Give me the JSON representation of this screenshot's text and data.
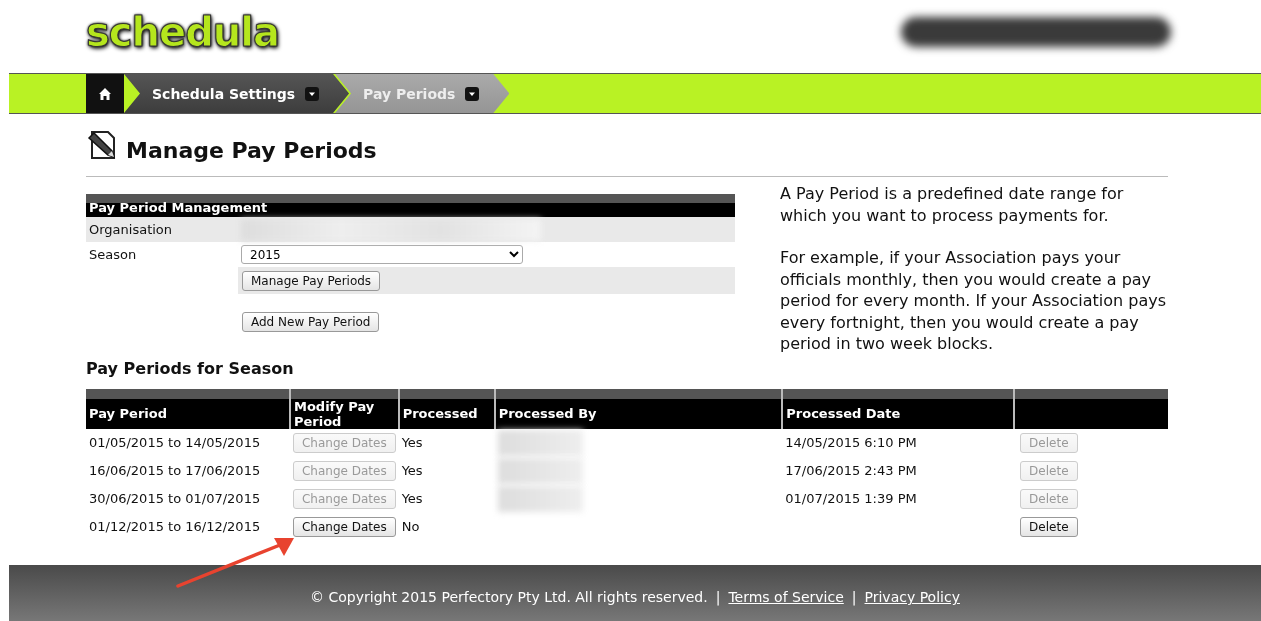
{
  "header": {
    "logo": "schedula",
    "account_blurred": true
  },
  "breadcrumb": [
    {
      "kind": "home",
      "selected": false
    },
    {
      "kind": "link",
      "label": "Schedula Settings",
      "selected": false
    },
    {
      "kind": "link",
      "label": "Pay Periods",
      "selected": true
    }
  ],
  "page_title": "Manage Pay Periods",
  "management": {
    "title": "Pay Period Management",
    "organisation": {
      "label": "Organisation",
      "blurred": true
    },
    "season": {
      "label": "Season",
      "value": "2015"
    },
    "manage_button": "Manage Pay Periods",
    "add_button": "Add New Pay Period"
  },
  "info": [
    "A Pay Period is a predefined date range for which you want to process payments for.",
    "For example, if your Association pays your officials monthly, then you would create a pay period for every month. If your Association pays every fortnight, then you would create a pay period in two week blocks."
  ],
  "table": {
    "title": "Pay Periods for Season",
    "columns": [
      "Pay Period",
      "Modify Pay Period",
      "Processed",
      "Processed By",
      "Processed Date"
    ],
    "rows": [
      {
        "period": "01/05/2015 to 14/05/2015",
        "change": {
          "label": "Change Dates",
          "disabled": true
        },
        "processed": "Yes",
        "processed_by_blurred": true,
        "date": "14/05/2015 6:10 PM",
        "delete": {
          "label": "Delete",
          "disabled": true
        }
      },
      {
        "period": "16/06/2015 to 17/06/2015",
        "change": {
          "label": "Change Dates",
          "disabled": true
        },
        "processed": "Yes",
        "processed_by_blurred": true,
        "date": "17/06/2015 2:43 PM",
        "delete": {
          "label": "Delete",
          "disabled": true
        }
      },
      {
        "period": "30/06/2015 to 01/07/2015",
        "change": {
          "label": "Change Dates",
          "disabled": true
        },
        "processed": "Yes",
        "processed_by_blurred": true,
        "date": "01/07/2015 1:39 PM",
        "delete": {
          "label": "Delete",
          "disabled": true
        }
      },
      {
        "period": "01/12/2015 to 16/12/2015",
        "change": {
          "label": "Change Dates",
          "disabled": false
        },
        "processed": "No",
        "processed_by_blurred": false,
        "delete": {
          "label": "Delete",
          "disabled": false
        }
      }
    ]
  },
  "annotation": {
    "arrow": true
  },
  "footer": {
    "copyright": "© Copyright 2015 Perfectory Pty Ltd. All rights reserved.",
    "links": [
      "Terms of Service",
      "Privacy Policy"
    ],
    "separator": "|"
  }
}
